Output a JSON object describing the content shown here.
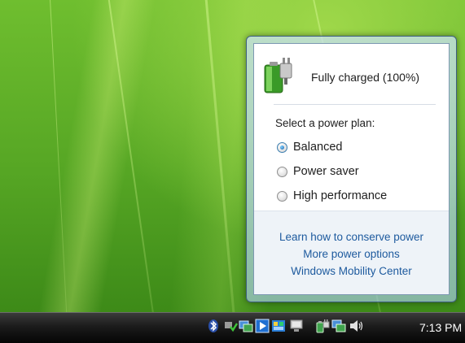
{
  "battery": {
    "status": "Fully charged (100%)",
    "icon": "battery-plug-icon"
  },
  "power_plans": {
    "title": "Select a power plan:",
    "options": [
      {
        "label": "Balanced",
        "selected": true
      },
      {
        "label": "Power saver",
        "selected": false
      },
      {
        "label": "High performance",
        "selected": false
      }
    ]
  },
  "links": {
    "conserve": "Learn how to conserve power",
    "more_options": "More power options",
    "mobility_center": "Windows Mobility Center"
  },
  "taskbar": {
    "clock": "7:13 PM",
    "tray_icons": [
      "bluetooth-icon",
      "safely-remove-icon",
      "network-icon",
      "media-player-icon",
      "task-manager-icon",
      "display-icon",
      "power-icon",
      "network-connection-icon",
      "volume-icon"
    ]
  },
  "colors": {
    "link": "#1d5a9e",
    "wallpaper": "#5aa52a",
    "taskbar": "#1b1b1b"
  }
}
